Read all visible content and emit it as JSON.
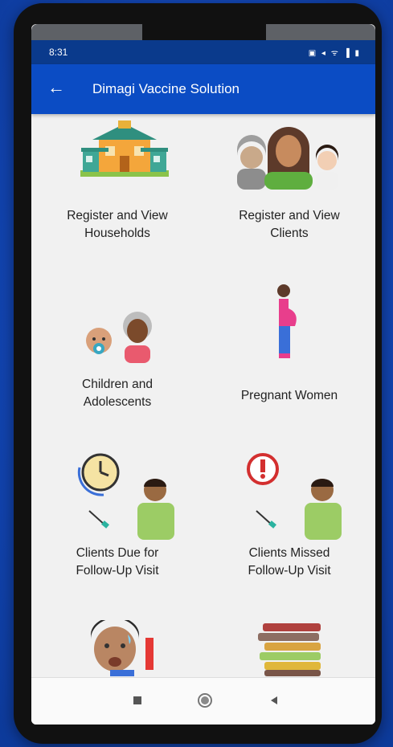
{
  "status_bar": {
    "time": "8:31",
    "icons": "▣ ◂ ᯤ ▐ ▮"
  },
  "app_bar": {
    "title": "Dimagi Vaccine Solution",
    "back_icon": "←"
  },
  "tiles": [
    {
      "label": "Register and View\nHouseholds",
      "icon": "house-icon"
    },
    {
      "label": "Register and View\nClients",
      "icon": "family-icon"
    },
    {
      "label": "Children and\nAdolescents",
      "icon": "children-icon"
    },
    {
      "label": "Pregnant Women",
      "icon": "pregnant-woman-icon"
    },
    {
      "label": "Clients Due for\nFollow-Up Visit",
      "icon": "clock-vaccine-icon"
    },
    {
      "label": "Clients Missed\nFollow-Up Visit",
      "icon": "alert-vaccine-icon"
    },
    {
      "label": "",
      "icon": "sick-person-icon"
    },
    {
      "label": "",
      "icon": "books-icon"
    }
  ],
  "colors": {
    "app_bar": "#0b4cc4",
    "status_bar": "#0a3a8c",
    "background": "#f1f1f1"
  }
}
